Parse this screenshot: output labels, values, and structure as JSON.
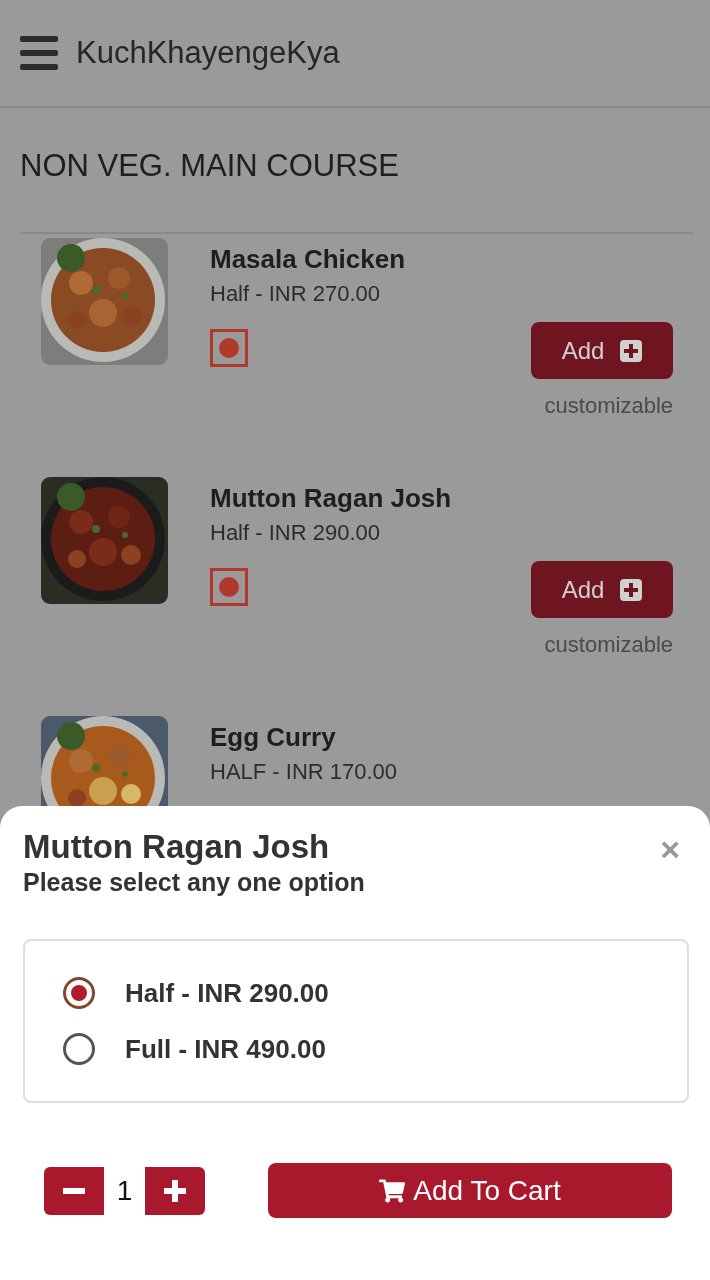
{
  "header": {
    "app_title": "KuchKhayengeKya"
  },
  "section_title": "NON VEG. MAIN COURSE",
  "items": [
    {
      "name": "Masala Chicken",
      "price_line": "Half - INR 270.00",
      "non_veg": true,
      "add_label": "Add",
      "note": "customizable"
    },
    {
      "name": "Mutton Ragan Josh",
      "price_line": "Half - INR 290.00",
      "non_veg": true,
      "add_label": "Add",
      "note": "customizable"
    },
    {
      "name": "Egg Curry",
      "price_line": "HALF - INR 170.00"
    }
  ],
  "sheet": {
    "title": "Mutton Ragan Josh",
    "subtitle": "Please select any one option",
    "close": "×",
    "options": [
      {
        "label": "Half - INR 290.00",
        "selected": true
      },
      {
        "label": "Full - INR 490.00",
        "selected": false
      }
    ],
    "quantity": "1",
    "add_to_cart": "Add To Cart"
  }
}
